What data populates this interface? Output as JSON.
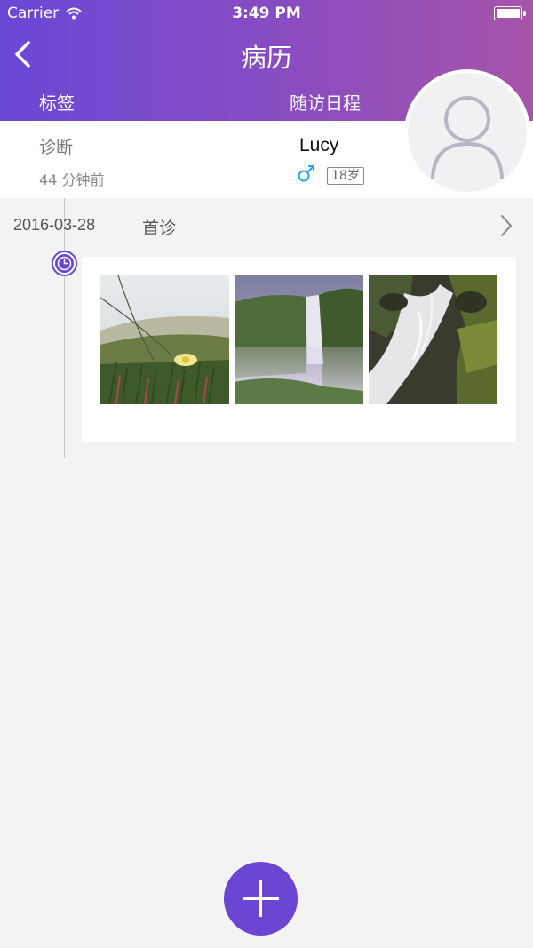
{
  "status_bar": {
    "carrier": "Carrier",
    "time": "3:49 PM"
  },
  "header": {
    "title": "病历",
    "tabs": [
      {
        "label": "标签"
      },
      {
        "label": "随访日程"
      }
    ]
  },
  "patient": {
    "diagnosis_label": "诊断",
    "updated": "44 分钟前",
    "name": "Lucy",
    "gender": "male",
    "age": "18岁"
  },
  "records": [
    {
      "date": "2016-03-28",
      "type": "首诊",
      "photos": [
        "flower-field",
        "waterfall-canyon",
        "waterfall-rocks"
      ]
    }
  ],
  "colors": {
    "accent": "#6b46d3",
    "header_start": "#6a48d6",
    "header_end": "#a655a8",
    "male": "#2aa7e6"
  },
  "icons": {
    "back": "chevron-left-icon",
    "gender": "male-icon",
    "avatar": "person-placeholder-icon",
    "clock": "clock-icon",
    "detail": "chevron-right-icon",
    "add": "plus-icon"
  }
}
